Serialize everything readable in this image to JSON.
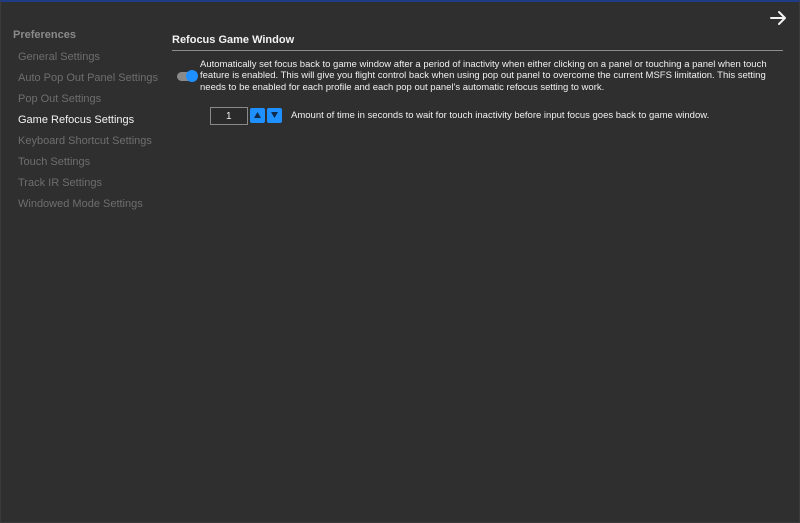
{
  "sidebar": {
    "title": "Preferences",
    "items": [
      {
        "label": "General Settings"
      },
      {
        "label": "Auto Pop Out Panel Settings"
      },
      {
        "label": "Pop Out Settings"
      },
      {
        "label": "Game Refocus Settings"
      },
      {
        "label": "Keyboard Shortcut Settings"
      },
      {
        "label": "Touch Settings"
      },
      {
        "label": "Track IR Settings"
      },
      {
        "label": "Windowed Mode Settings"
      }
    ],
    "active_item": "Game Refocus Settings"
  },
  "header": {
    "back_icon": "arrow-right-icon"
  },
  "main": {
    "section_title": "Refocus Game Window",
    "refocus_toggle": {
      "enabled": true,
      "description": "Automatically set focus back to game window after a period of inactivity when either clicking on a panel or touching a panel when touch feature is enabled. This will give you flight control back when using pop out panel to overcome the current MSFS limitation. This setting needs to be enabled for each profile and each pop out panel's automatic refocus setting to work."
    },
    "delay": {
      "value": "1",
      "label": "Amount of time in seconds to wait for touch inactivity before input focus goes back to game window."
    }
  },
  "colors": {
    "accent": "#1e90ff",
    "background": "#2f2f2f",
    "text": "#f0f0f0",
    "muted_text": "#6e6e6e",
    "title_bar_border": "#1f3c88"
  }
}
